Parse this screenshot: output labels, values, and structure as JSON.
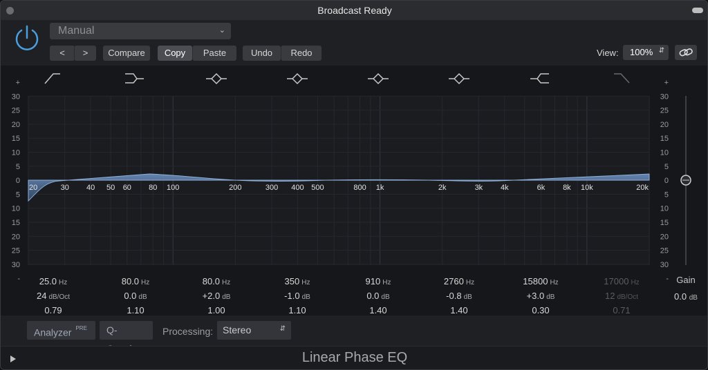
{
  "window": {
    "title": "Broadcast Ready"
  },
  "toolbar": {
    "preset": "Manual",
    "prev": "<",
    "next": ">",
    "compare": "Compare",
    "copy": "Copy",
    "paste": "Paste",
    "undo": "Undo",
    "redo": "Redo",
    "view_label": "View:",
    "view_value": "100%"
  },
  "graph": {
    "db_ticks": [
      "+",
      "30",
      "25",
      "20",
      "15",
      "10",
      "5",
      "0",
      "5",
      "10",
      "15",
      "20",
      "25",
      "30",
      "-"
    ],
    "freq_labels": [
      "20",
      "30",
      "40",
      "50",
      "60",
      "80",
      "100",
      "200",
      "300",
      "400",
      "500",
      "800",
      "1k",
      "2k",
      "3k",
      "4k",
      "6k",
      "8k",
      "10k",
      "20k"
    ]
  },
  "bands": [
    {
      "freq": "25.0",
      "freq_unit": "Hz",
      "gain": "24",
      "gain_unit": "dB/Oct",
      "q": "0.79",
      "dim": false,
      "icon": "low-cut-icon"
    },
    {
      "freq": "80.0",
      "freq_unit": "Hz",
      "gain": "0.0",
      "gain_unit": "dB",
      "q": "1.10",
      "dim": false,
      "icon": "low-shelf-icon"
    },
    {
      "freq": "80.0",
      "freq_unit": "Hz",
      "gain": "+2.0",
      "gain_unit": "dB",
      "q": "1.00",
      "dim": false,
      "icon": "bell-icon"
    },
    {
      "freq": "350",
      "freq_unit": "Hz",
      "gain": "-1.0",
      "gain_unit": "dB",
      "q": "1.10",
      "dim": false,
      "icon": "bell-icon"
    },
    {
      "freq": "910",
      "freq_unit": "Hz",
      "gain": "0.0",
      "gain_unit": "dB",
      "q": "1.40",
      "dim": false,
      "icon": "bell-icon"
    },
    {
      "freq": "2760",
      "freq_unit": "Hz",
      "gain": "-0.8",
      "gain_unit": "dB",
      "q": "1.40",
      "dim": false,
      "icon": "bell-icon"
    },
    {
      "freq": "15800",
      "freq_unit": "Hz",
      "gain": "+3.0",
      "gain_unit": "dB",
      "q": "0.30",
      "dim": false,
      "icon": "high-shelf-icon"
    },
    {
      "freq": "17000",
      "freq_unit": "Hz",
      "gain": "12",
      "gain_unit": "dB/Oct",
      "q": "0.71",
      "dim": true,
      "icon": "high-cut-icon"
    }
  ],
  "gain": {
    "label": "Gain",
    "value": "0.0",
    "unit": "dB"
  },
  "bottom": {
    "analyzer": "Analyzer",
    "analyzer_badge": "PRE",
    "q_couple": "Q-Couple",
    "processing_label": "Processing:",
    "processing_value": "Stereo"
  },
  "footer": {
    "title": "Linear Phase EQ"
  }
}
